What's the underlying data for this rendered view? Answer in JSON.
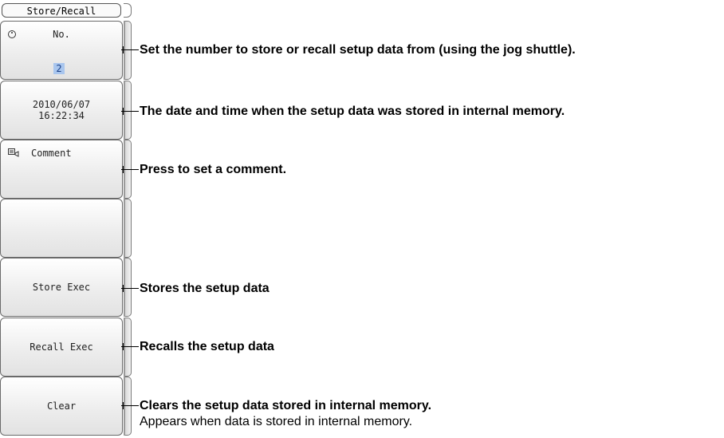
{
  "menu": {
    "title": "Store/Recall",
    "number_key": {
      "label": "No.",
      "value": "2"
    },
    "datetime_key": {
      "date": "2010/06/07",
      "time": "16:22:34"
    },
    "comment_key": {
      "label": "Comment",
      "icon": "comment-icon"
    },
    "store_key": {
      "label": "Store Exec"
    },
    "recall_key": {
      "label": "Recall Exec"
    },
    "clear_key": {
      "label": "Clear"
    }
  },
  "callouts": {
    "number": "Set the number to store or recall setup data from (using the jog shuttle).",
    "datetime": "The date and time when the setup data was stored in internal memory.",
    "comment": "Press to set a comment.",
    "store": "Stores the setup data",
    "recall": "Recalls the setup data",
    "clear": "Clears the setup data stored in internal memory.",
    "clear_note": "Appears when data is stored in internal memory."
  }
}
